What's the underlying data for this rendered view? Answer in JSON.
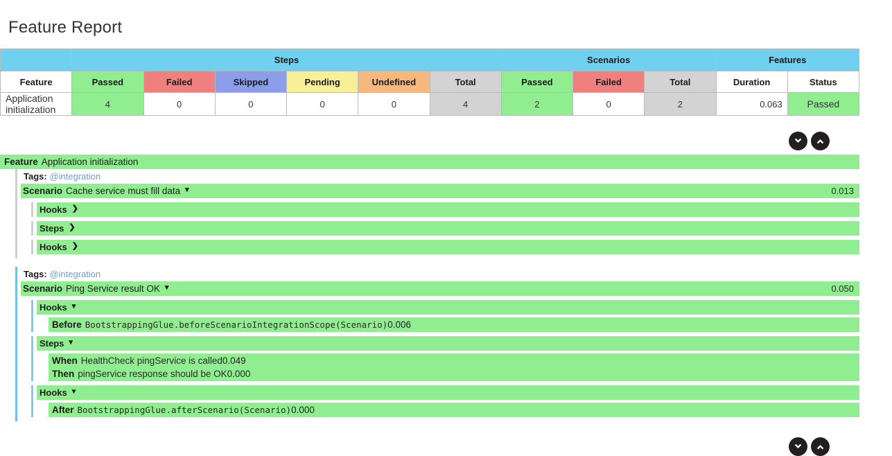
{
  "page": {
    "title": "Feature Report"
  },
  "summary_table": {
    "groups": [
      {
        "label": "",
        "span": 1
      },
      {
        "label": "Steps",
        "span": 6
      },
      {
        "label": "Scenarios",
        "span": 3
      },
      {
        "label": "Features",
        "span": 2
      }
    ],
    "headers": [
      "Feature",
      "Passed",
      "Failed",
      "Skipped",
      "Pending",
      "Undefined",
      "Total",
      "Passed",
      "Failed",
      "Total",
      "Duration",
      "Status"
    ],
    "rows": [
      {
        "feature": "Application initialization",
        "steps_passed": "4",
        "steps_failed": "0",
        "steps_skipped": "0",
        "steps_pending": "0",
        "steps_undefined": "0",
        "steps_total": "4",
        "scenarios_passed": "2",
        "scenarios_failed": "0",
        "scenarios_total": "2",
        "duration": "0.063",
        "status": "Passed"
      }
    ],
    "colors": {
      "group_header": "#6FD0EF",
      "passed": "#90EE90",
      "failed": "#F08080",
      "skipped": "#8C9EEB",
      "pending": "#F7F098",
      "undefined": "#F5B97D",
      "total": "#D3D3D3"
    }
  },
  "toolbar": {
    "expand_all_icon": "chevron-down-circle-icon",
    "collapse_all_icon": "chevron-up-circle-icon"
  },
  "report": {
    "feature": {
      "keyword": "Feature",
      "name": "Application initialization"
    },
    "scenarios": [
      {
        "tags_label": "Tags:",
        "tags": "@integration",
        "keyword": "Scenario",
        "name": "Cache service must fill data",
        "chevron": "▾",
        "duration": "0.013",
        "expanded": false,
        "sections": [
          {
            "label": "Hooks",
            "chevron": "❯",
            "expanded": false,
            "entries": []
          },
          {
            "label": "Steps",
            "chevron": "❯",
            "expanded": false,
            "entries": []
          },
          {
            "label": "Hooks",
            "chevron": "❯",
            "expanded": false,
            "entries": []
          }
        ]
      },
      {
        "tags_label": "Tags:",
        "tags": "@integration",
        "keyword": "Scenario",
        "name": "Ping Service result OK",
        "chevron": "▾",
        "duration": "0.050",
        "expanded": true,
        "sections": [
          {
            "label": "Hooks",
            "chevron": "▾",
            "expanded": true,
            "entries": [
              {
                "keyword": "Before",
                "text": "BootstrappingGlue.beforeScenarioIntegrationScope(Scenario)",
                "mono": true,
                "duration": "0.006"
              }
            ]
          },
          {
            "label": "Steps",
            "chevron": "▾",
            "expanded": true,
            "entries": [
              {
                "keyword": "When",
                "text": "HealthCheck pingService is called",
                "mono": false,
                "duration": "0.049"
              },
              {
                "keyword": "Then",
                "text": "pingService response should be OK",
                "mono": false,
                "duration": "0.000"
              }
            ]
          },
          {
            "label": "Hooks",
            "chevron": "▾",
            "expanded": true,
            "entries": [
              {
                "keyword": "After",
                "text": "BootstrappingGlue.afterScenario(Scenario)",
                "mono": true,
                "duration": "0.000"
              }
            ]
          }
        ]
      }
    ]
  }
}
